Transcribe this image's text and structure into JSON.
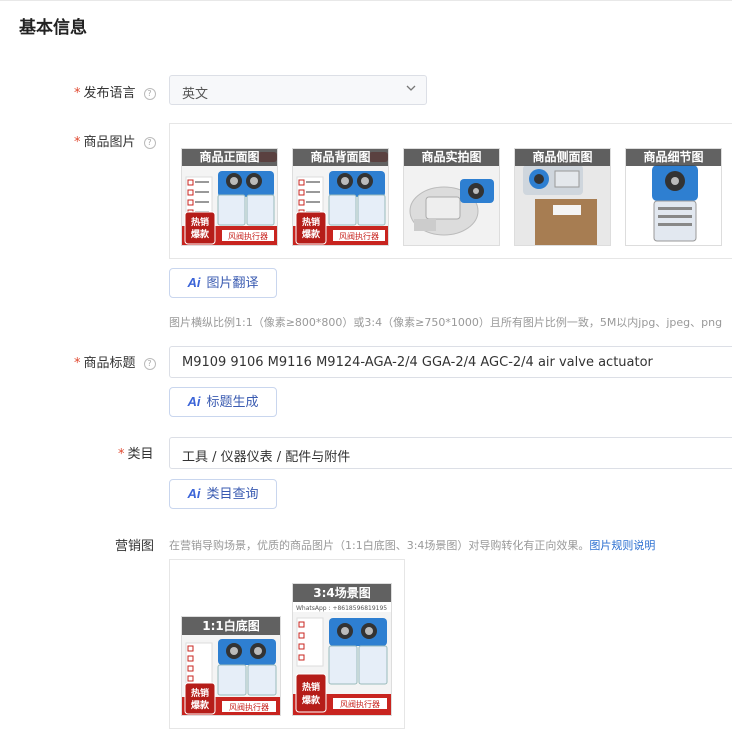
{
  "section": {
    "title": "基本信息"
  },
  "language": {
    "label": "发布语言",
    "value": "英文"
  },
  "product_images": {
    "label": "商品图片",
    "thumbs": [
      {
        "caption": "商品正面图"
      },
      {
        "caption": "商品背面图"
      },
      {
        "caption": "商品实拍图"
      },
      {
        "caption": "商品侧面图"
      },
      {
        "caption": "商品细节图"
      }
    ],
    "translate_button": "图片翻译",
    "hint": "图片横纵比例1:1（像素≥800*800）或3:4（像素≥750*1000）且所有图片比例一致，5M以内jpg、jpeg、png"
  },
  "product_title": {
    "label": "商品标题",
    "value": "M9109 9106 M9116 M9124-AGA-2/4 GGA-2/4 AGC-2/4 air valve actuator",
    "generate_button": "标题生成"
  },
  "category": {
    "label": "类目",
    "value": "工具 / 仪器仪表 / 配件与附件",
    "query_button": "类目查询"
  },
  "marketing": {
    "label": "营销图",
    "desc": "在营销导购场景，优质的商品图片（1:1白底图、3:4场景图）对导购转化有正向效果。",
    "link": "图片规则说明",
    "thumbs": [
      {
        "caption": "1:1白底图"
      },
      {
        "caption": "3:4场景图"
      }
    ]
  },
  "ai_badge": "Ai",
  "product_art": {
    "promo_line1": "热销",
    "promo_line2": "爆款",
    "product_name": "风阀执行器",
    "contact": "WhatsApp : +8618596819195"
  },
  "colors": {
    "accent": "#3b64d8",
    "required": "#e0482f",
    "link": "#2b6fd1",
    "promo_red": "#c8241f",
    "actuator_blue": "#2e7fd1"
  }
}
